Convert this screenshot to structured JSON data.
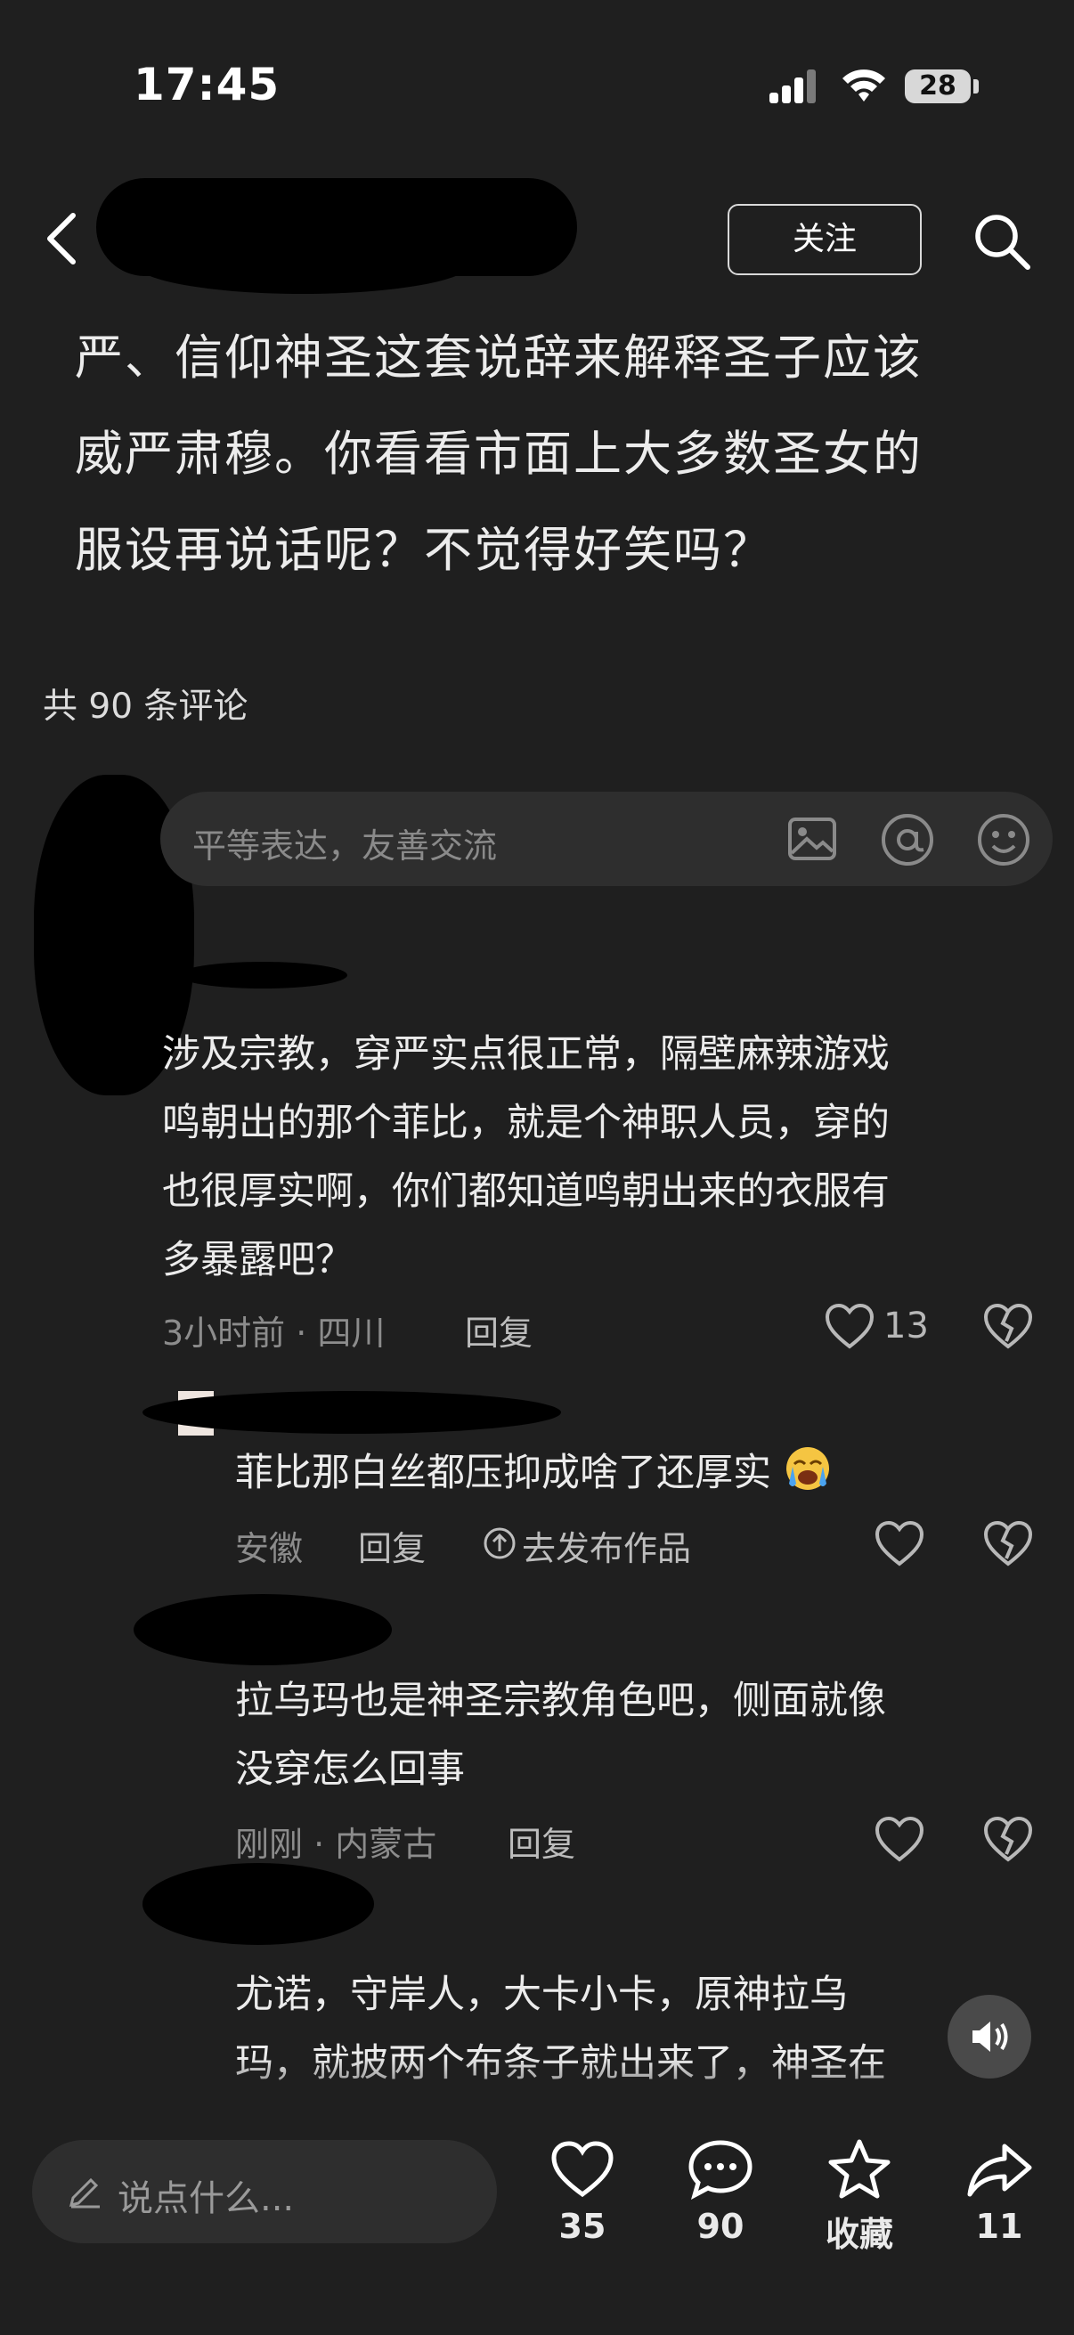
{
  "status_bar": {
    "time": "17:45",
    "battery": "28"
  },
  "header": {
    "follow_label": "关注"
  },
  "post": {
    "lines": [
      "严、信仰神圣这套说辞来解释圣子应该",
      "威严肃穆。你看看市面上大多数圣女的",
      "服设再说话呢？不觉得好笑吗？"
    ]
  },
  "comments_header": {
    "count_text": "共 90 条评论"
  },
  "comment_input": {
    "placeholder": "平等表达，友善交流",
    "icons": [
      "image-icon",
      "at-icon",
      "emoji-icon"
    ]
  },
  "comments": [
    {
      "lines": [
        "涉及宗教，穿严实点很正常，隔壁麻辣游戏",
        "鸣朝出的那个菲比，就是个神职人员，穿的",
        "也很厚实啊，你们都知道鸣朝出来的衣服有",
        "多暴露吧？"
      ],
      "meta": "3小时前 · 四川",
      "reply_label": "回复",
      "likes": "13"
    }
  ],
  "replies": [
    {
      "text": "菲比那白丝都压抑成啥了还厚实",
      "meta": "安徽",
      "reply_label": "回复",
      "extra_label": "去发布作品"
    },
    {
      "lines": [
        "拉乌玛也是神圣宗教角色吧，侧面就像",
        "没穿怎么回事"
      ],
      "meta": "刚刚 · 内蒙古",
      "reply_label": "回复"
    },
    {
      "lines": [
        "尤诺，守岸人，大卡小卡，原神拉乌",
        "玛，就披两个布条子就出来了，神圣在"
      ]
    }
  ],
  "bottom_bar": {
    "input_placeholder": "说点什么...",
    "likes": "35",
    "comments": "90",
    "favorite_label": "收藏",
    "shares": "11"
  }
}
